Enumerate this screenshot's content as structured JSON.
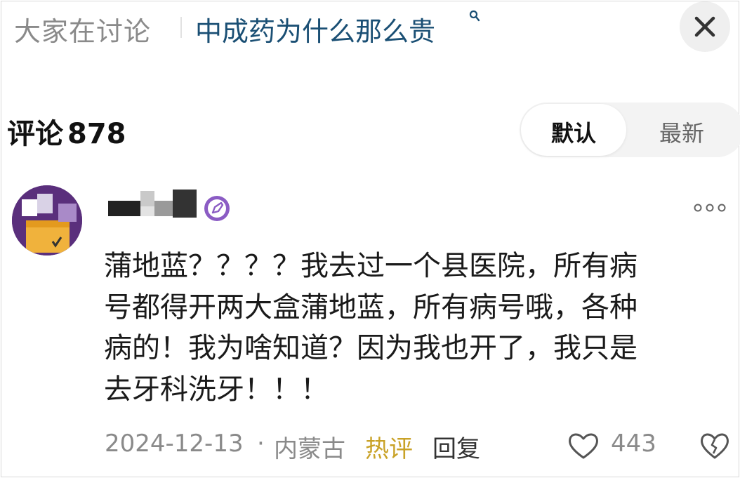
{
  "header": {
    "discuss_label": "大家在讨论",
    "topic": "中成药为什么那么贵"
  },
  "comments_section": {
    "title": "评论",
    "count": "878",
    "sort_default": "默认",
    "sort_latest": "最新"
  },
  "comment": {
    "text": "蒲地蓝？？？？我去过一个县医院，所有病\n号都得开两大盒蒲地蓝，所有病号哦，各种\n病的！我为啥知道？因为我也开了，我只是\n去牙科洗牙！！！",
    "date": "2024-12-13",
    "separator": "·",
    "region": "内蒙古",
    "hot_tag": "热评",
    "reply_label": "回复",
    "likes": "443"
  },
  "colors": {
    "topic": "#1a4f74",
    "hot_tag": "#c9a227",
    "avatar_bg": "#5a2f7c",
    "badge": "#8b5cc4"
  },
  "icons": [
    "search-icon",
    "close-icon",
    "badge-icon",
    "more-icon",
    "heart-icon",
    "broken-heart-icon"
  ]
}
